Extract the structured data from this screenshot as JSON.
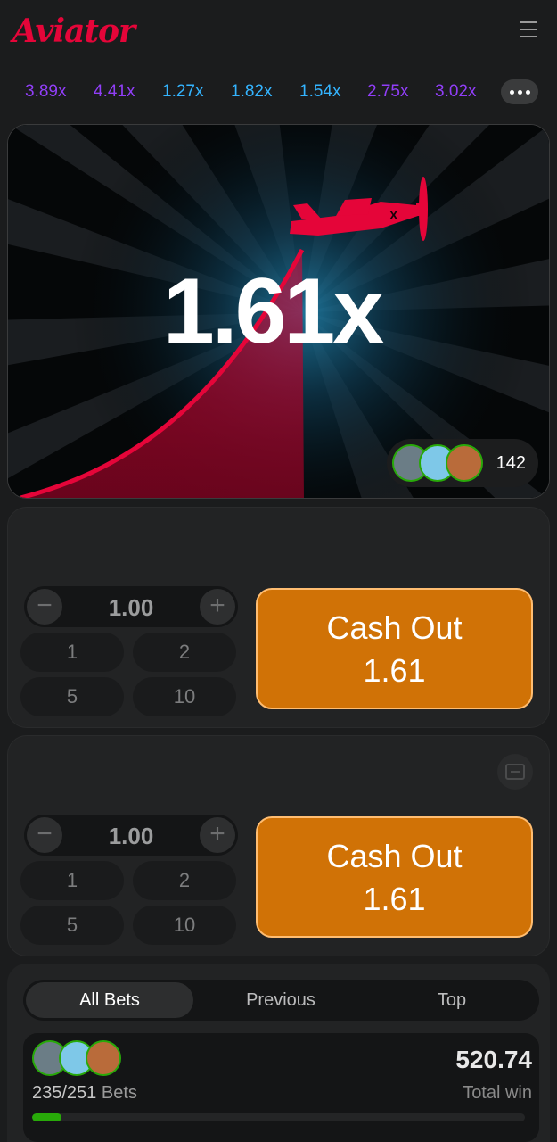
{
  "app": {
    "logo_text": "Aviator"
  },
  "history": {
    "items": [
      {
        "value": "3.89x",
        "color": "#913ef8"
      },
      {
        "value": "4.41x",
        "color": "#913ef8"
      },
      {
        "value": "1.27x",
        "color": "#34b4ff"
      },
      {
        "value": "1.82x",
        "color": "#34b4ff"
      },
      {
        "value": "1.54x",
        "color": "#34b4ff"
      },
      {
        "value": "2.75x",
        "color": "#913ef8"
      },
      {
        "value": "3.02x",
        "color": "#913ef8"
      }
    ],
    "more_icon": "ellipsis-icon"
  },
  "game": {
    "multiplier": "1.61x",
    "plane_color": "#e50539",
    "players_count": "142"
  },
  "bet_panels": [
    {
      "amount": "1.00",
      "quick_amounts": [
        "1",
        "2",
        "5",
        "10"
      ],
      "cashout_label": "Cash Out",
      "cashout_value": "1.61"
    },
    {
      "amount": "1.00",
      "quick_amounts": [
        "1",
        "2",
        "5",
        "10"
      ],
      "cashout_label": "Cash Out",
      "cashout_value": "1.61",
      "toggle_icon": "minus-square-icon"
    }
  ],
  "bets": {
    "tabs": [
      {
        "label": "All Bets",
        "active": true
      },
      {
        "label": "Previous",
        "active": false
      },
      {
        "label": "Top",
        "active": false
      }
    ],
    "bets_ratio": "235/251",
    "bets_label": "Bets",
    "total_win": "520.74",
    "total_win_label": "Total win",
    "progress_fraction": 0.06
  },
  "colors": {
    "accent_red": "#e50539",
    "cashout_orange": "#d07206",
    "progress_green": "#28a909"
  }
}
